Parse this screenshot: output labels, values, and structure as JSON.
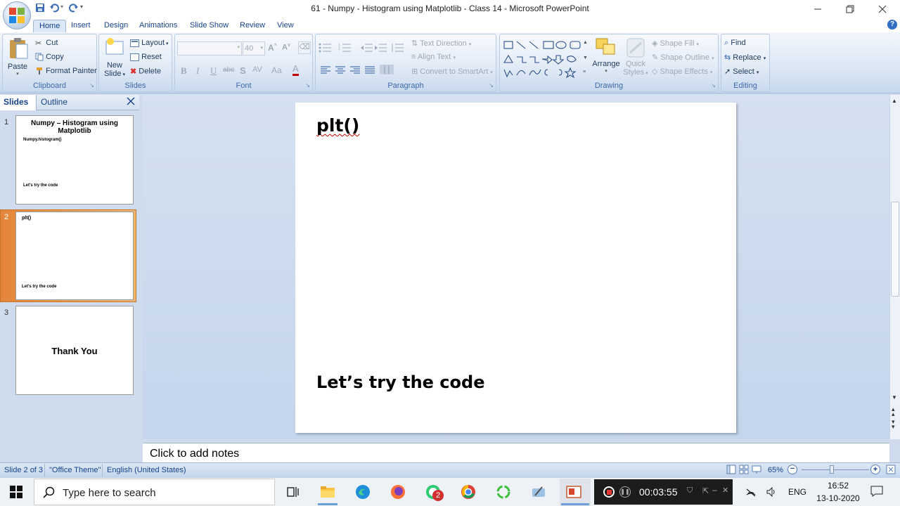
{
  "window": {
    "title": "61 - Numpy - Histogram using Matplotlib - Class 14 - Microsoft PowerPoint",
    "minimize_icon": "minimize-icon",
    "restore_icon": "restore-icon",
    "close_icon": "close-icon"
  },
  "ribbon_tabs": [
    "Home",
    "Insert",
    "Design",
    "Animations",
    "Slide Show",
    "Review",
    "View"
  ],
  "clipboard": {
    "label": "Clipboard",
    "paste": "Paste",
    "cut": "Cut",
    "copy": "Copy",
    "format_painter": "Format Painter"
  },
  "slides_group": {
    "label": "Slides",
    "new_slide_1": "New",
    "new_slide_2": "Slide",
    "layout": "Layout",
    "reset": "Reset",
    "delete": "Delete"
  },
  "font_group": {
    "label": "Font",
    "font_name": "",
    "font_size": "40"
  },
  "paragraph": {
    "label": "Paragraph",
    "text_direction": "Text Direction",
    "align_text": "Align Text",
    "convert_smartart": "Convert to SmartArt"
  },
  "drawing": {
    "label": "Drawing",
    "arrange": "Arrange",
    "quick_styles_1": "Quick",
    "quick_styles_2": "Styles",
    "shape_fill": "Shape Fill",
    "shape_outline": "Shape Outline",
    "shape_effects": "Shape Effects"
  },
  "editing": {
    "label": "Editing",
    "find": "Find",
    "replace": "Replace",
    "select": "Select"
  },
  "panel": {
    "slides_tab": "Slides",
    "outline_tab": "Outline"
  },
  "thumbnails": [
    {
      "num": "1",
      "title": "Numpy – Histogram using Matplotlib",
      "line1": "Numpy.histogram()",
      "line2": "Let's try the code"
    },
    {
      "num": "2",
      "title": "plt()",
      "line2": "Let's try the code"
    },
    {
      "num": "3",
      "title": "Thank You"
    }
  ],
  "slide": {
    "title": "plt()",
    "body": "Let’s try the code"
  },
  "notes_placeholder": "Click to add notes",
  "status": {
    "slide": "Slide 2 of 3",
    "theme": "\"Office Theme\"",
    "language": "English (United States)",
    "zoom": "65%",
    "zoom_fraction": 0.45
  },
  "taskbar": {
    "search_placeholder": "Type here to search",
    "whatsapp_badge": "2",
    "recorder_time": "00:03:55",
    "lang": "ENG",
    "time": "16:52",
    "date": "13-10-2020"
  },
  "colors": {
    "accent": "#15428b",
    "ribbon": "#dbe6f4",
    "selected_thumb": "#e3853a",
    "workspace": "#cfdcee"
  }
}
